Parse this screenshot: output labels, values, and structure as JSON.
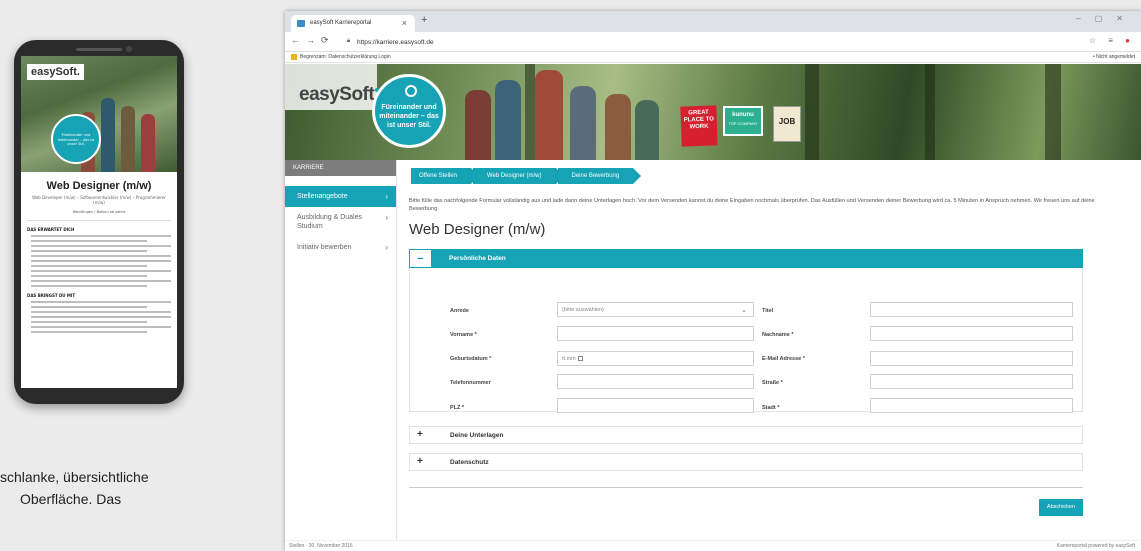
{
  "phone": {
    "logo": "easySoft.",
    "badge": "Füreinander und miteinander – das ist unser Stil.",
    "title": "Web Designer (m/w)",
    "subtitle": "Web Developer (m/w) – Softwareentwickler (m/w) – Programmierer (m/w)",
    "meta": "Wendlingen / Bohlen   ab sofort",
    "section1": "DAS ERWARTET DICH",
    "section2": "DAS BRINGST DU MIT"
  },
  "caption": {
    "line1": "schlanke, übersichtliche",
    "line2": "Oberfläche. Das"
  },
  "browser": {
    "tab_title": "easySoft Karriereportal",
    "url": "https://karriere.easysoft.de",
    "bookmark": "Begrenzam: Datenschutzerklärung Login",
    "bookmark_right": "• Nicht angemeldet"
  },
  "hero": {
    "logo": "easySoft",
    "circle_text": "Füreinander und miteinander – das ist unser Stil.",
    "award_gptw": "GREAT PLACE TO WORK",
    "award_kununu": "kununu",
    "award_kununu_sub": "TOP COMPANY",
    "award_job": "JOB"
  },
  "sidenav": {
    "header": "KARRIERE",
    "items": [
      {
        "label": "Stellenangebote"
      },
      {
        "label": "Ausbildung & Duales Studium"
      },
      {
        "label": "Initiativ bewerben"
      }
    ]
  },
  "breadcrumbs": [
    "Offene Stellen",
    "Web Designer (m/w)",
    "Deine Bewerbung"
  ],
  "intro": "Bitte fülle das nachfolgende Formular vollständig aus und lade dann deine Unterlagen hoch. Vor dem Versenden kannst du deine Eingaben nochmals überprüfen. Das Ausfüllen und Versenden deiner Bewerbung wird ca. 5 Minuten in Anspruch nehmen. Wir freuen uns auf deine Bewerbung.",
  "page_title": "Web Designer (m/w)",
  "section_personal": "Persönliche Daten",
  "form": {
    "anrede": "Anrede",
    "anrede_value": "(bitte auswählen)",
    "titel": "Titel",
    "vorname": "Vorname *",
    "nachname": "Nachname *",
    "geburtsdatum": "Geburtsdatum *",
    "geburtsdatum_placeholder": "tt.mm",
    "email": "E-Mail Adresse *",
    "telefon": "Telefonnummer",
    "strasse": "Straße *",
    "plz": "PLZ *",
    "stadt": "Stadt *"
  },
  "section_documents": "Deine Unterlagen",
  "section_privacy": "Datenschutz",
  "submit": "Abschicken",
  "footer": {
    "left": "Stellen · 30. November 2016",
    "right": "Karriereportal powered by easySoft"
  },
  "colors": {
    "accent": "#15a3b5",
    "nav_header": "#7c7c7c"
  }
}
